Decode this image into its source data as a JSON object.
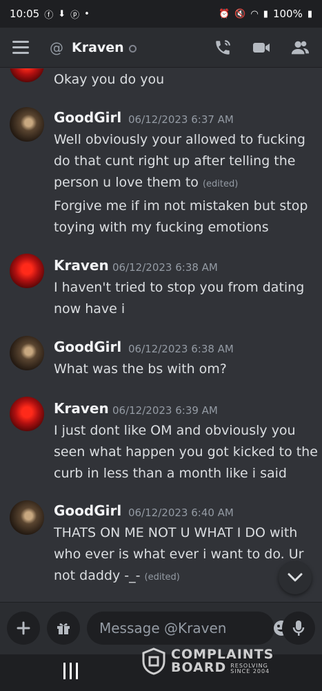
{
  "status_bar": {
    "time": "10:05",
    "left_icons": [
      "facebook-icon",
      "download-icon",
      "pinterest-icon",
      "dot"
    ],
    "battery": "100%"
  },
  "header": {
    "channel_prefix": "@",
    "title": "Kraven"
  },
  "messages": {
    "prev_text": "Okay you do you",
    "m1": {
      "author": "GoodGirl",
      "time": "06/12/2023 6:37 AM",
      "lines": [
        "Well obviously your allowed to fucking",
        "do that cunt right up after telling the",
        "person u love them to"
      ],
      "edited": "(edited)",
      "lines2": [
        "Forgive me if im not mistaken but stop",
        "toying with my fucking emotions"
      ]
    },
    "m2": {
      "author": "Kraven",
      "time": "06/12/2023 6:38 AM",
      "lines": [
        "I haven't tried to stop you from dating",
        "now have i"
      ]
    },
    "m3": {
      "author": "GoodGirl",
      "time": "06/12/2023 6:38 AM",
      "lines": [
        "What was the bs with om?"
      ]
    },
    "m4": {
      "author": "Kraven",
      "time": "06/12/2023 6:39 AM",
      "lines": [
        "I just dont like OM and obviously you",
        "seen what happen you got kicked to the",
        "curb in less than a month like i said"
      ]
    },
    "m5": {
      "author": "GoodGirl",
      "time": "06/12/2023 6:40 AM",
      "lines": [
        "THATS ON ME NOT U WHAT I DO with",
        "who ever is what ever i want to do. Ur",
        "not daddy -_-"
      ],
      "edited": "(edited)"
    }
  },
  "composer": {
    "placeholder": "Message @Kraven"
  },
  "watermark": {
    "line1": "COMPLAINTS",
    "line2": "BOARD",
    "tag1": "RESOLVING",
    "tag2": "SINCE 2004"
  }
}
